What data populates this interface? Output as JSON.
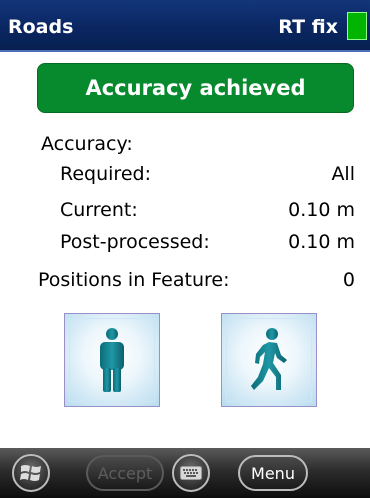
{
  "titlebar": {
    "title": "Roads",
    "fix_status": "RT fix",
    "fix_color": "#00b400"
  },
  "status_banner": {
    "text": "Accuracy achieved",
    "color": "#078a2e"
  },
  "accuracy": {
    "heading": "Accuracy:",
    "required_label": "Required:",
    "required_value": "All",
    "current_label": "Current:",
    "current_value": "0.10 m",
    "post_label": "Post-processed:",
    "post_value": "0.10 m"
  },
  "positions": {
    "label": "Positions in Feature:",
    "value": "0"
  },
  "buttons": {
    "standing_icon": "standing-person-icon",
    "walking_icon": "walking-person-icon"
  },
  "softkeys": {
    "start_icon": "windows-start-icon",
    "accept_label": "Accept",
    "accept_enabled": false,
    "keyboard_icon": "keyboard-icon",
    "menu_label": "Menu"
  }
}
